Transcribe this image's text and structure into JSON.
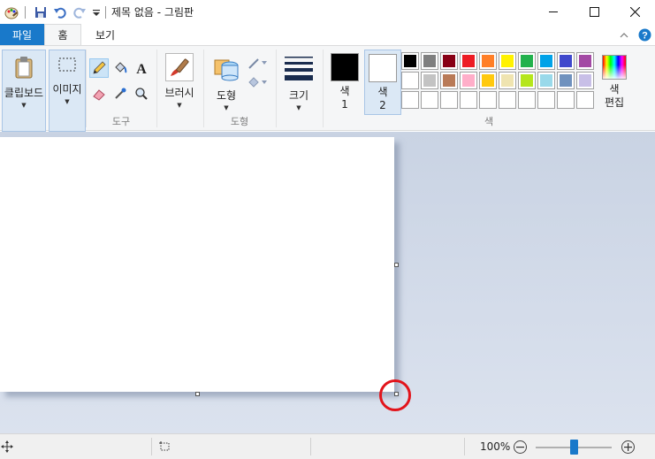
{
  "window": {
    "title": "제목 없음 - 그림판"
  },
  "tabs": {
    "file": "파일",
    "home": "홈",
    "view": "보기"
  },
  "ribbon": {
    "clipboard": {
      "label": "클립보드"
    },
    "image": {
      "label": "이미지"
    },
    "tools": {
      "group_label": "도구"
    },
    "brushes": {
      "label": "브러시"
    },
    "shapes": {
      "label": "도형",
      "group_label": "도형"
    },
    "size": {
      "label": "크기"
    },
    "colors": {
      "color1_label": "색",
      "color1_num": "1",
      "color2_label": "색",
      "color2_num": "2",
      "group_label": "색",
      "edit_label_1": "색",
      "edit_label_2": "편집",
      "color1_value": "#000000",
      "color2_value": "#ffffff",
      "palette_row1": [
        "#000000",
        "#7f7f7f",
        "#880015",
        "#ed1c24",
        "#ff7f27",
        "#fff200",
        "#22b14c",
        "#00a2e8",
        "#3f48cc",
        "#a349a4"
      ],
      "palette_row2": [
        "#ffffff",
        "#c3c3c3",
        "#b97a57",
        "#ffaec9",
        "#ffc90e",
        "#efe4b0",
        "#b5e61d",
        "#99d9ea",
        "#7092be",
        "#c8bfe7"
      ],
      "palette_row3": [
        "#ffffff",
        "#ffffff",
        "#ffffff",
        "#ffffff",
        "#ffffff",
        "#ffffff",
        "#ffffff",
        "#ffffff",
        "#ffffff",
        "#ffffff"
      ]
    }
  },
  "statusbar": {
    "zoom": "100%",
    "zoom_level": 100
  }
}
